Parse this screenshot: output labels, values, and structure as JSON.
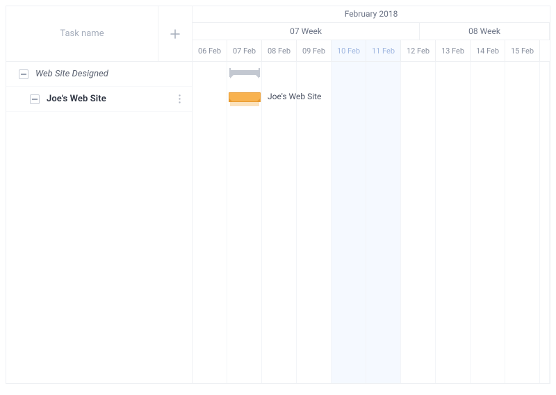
{
  "sidebar": {
    "header_label": "Task name"
  },
  "tasks": [
    {
      "name": "Web Site Designed",
      "level": 0,
      "style": "italic"
    },
    {
      "name": "Joe's Web Site",
      "level": 1,
      "style": "bold"
    }
  ],
  "timeline": {
    "month": "February 2018",
    "weeks": [
      {
        "label": "07 Week",
        "span_days": 7
      },
      {
        "label": "08 Week",
        "span_days": 4
      }
    ],
    "days": [
      {
        "label": "06 Feb",
        "weekend": false
      },
      {
        "label": "07 Feb",
        "weekend": false
      },
      {
        "label": "08 Feb",
        "weekend": false
      },
      {
        "label": "09 Feb",
        "weekend": false
      },
      {
        "label": "10 Feb",
        "weekend": true
      },
      {
        "label": "11 Feb",
        "weekend": true
      },
      {
        "label": "12 Feb",
        "weekend": false
      },
      {
        "label": "13 Feb",
        "weekend": false
      },
      {
        "label": "14 Feb",
        "weekend": false
      },
      {
        "label": "15 Feb",
        "weekend": false
      }
    ],
    "bars": {
      "summary": {
        "row": 0,
        "start_day_index": 1,
        "duration_days": 1
      },
      "task": {
        "row": 1,
        "start_day_index": 1,
        "duration_days": 1,
        "label": "Joe's Web Site"
      }
    }
  }
}
